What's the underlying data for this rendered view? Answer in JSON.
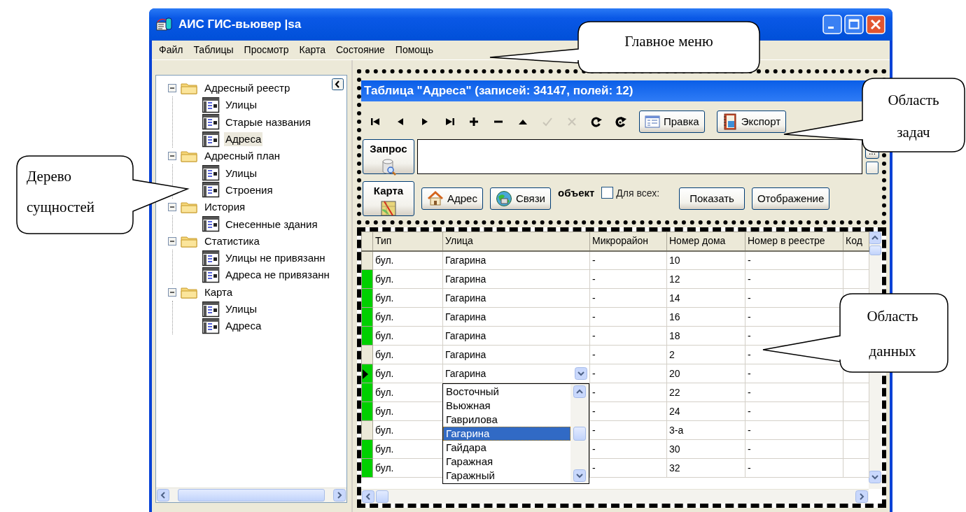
{
  "window": {
    "title": "АИС ГИС-вьювер |sa"
  },
  "menu": [
    "Файл",
    "Таблицы",
    "Просмотр",
    "Карта",
    "Состояние",
    "Помощь"
  ],
  "tree": [
    {
      "label": "Адресный реестр",
      "kind": "folder",
      "expanded": true,
      "selected": false,
      "children": [
        {
          "label": "Улицы",
          "kind": "table",
          "selected": false
        },
        {
          "label": "Старые названия",
          "kind": "table",
          "selected": false
        },
        {
          "label": "Адреса",
          "kind": "table",
          "selected": true
        }
      ]
    },
    {
      "label": "Адресный план",
      "kind": "folder",
      "expanded": true,
      "selected": false,
      "children": [
        {
          "label": "Улицы",
          "kind": "table",
          "selected": false
        },
        {
          "label": "Строения",
          "kind": "table",
          "selected": false
        }
      ]
    },
    {
      "label": "История",
      "kind": "folder",
      "expanded": true,
      "selected": false,
      "children": [
        {
          "label": "Снесенные здания",
          "kind": "table",
          "selected": false
        }
      ]
    },
    {
      "label": "Статистика",
      "kind": "folder",
      "expanded": true,
      "selected": false,
      "children": [
        {
          "label": "Улицы не привязанн",
          "kind": "table",
          "selected": false
        },
        {
          "label": "Адреса не привязанн",
          "kind": "table",
          "selected": false
        }
      ]
    },
    {
      "label": "Карта",
      "kind": "folder",
      "expanded": true,
      "selected": false,
      "children": [
        {
          "label": "Улицы",
          "kind": "table",
          "selected": false
        },
        {
          "label": "Адреса",
          "kind": "table",
          "selected": false
        }
      ]
    }
  ],
  "table_panel": {
    "title": "Таблица \"Адреса\" (записей: 34147, полей: 12)",
    "nav_buttons": [
      {
        "kind": "first",
        "disabled": false
      },
      {
        "kind": "prev",
        "disabled": false
      },
      {
        "kind": "next",
        "disabled": false
      },
      {
        "kind": "last",
        "disabled": false
      },
      {
        "kind": "insert",
        "disabled": false
      },
      {
        "kind": "delete",
        "disabled": false
      },
      {
        "kind": "edit",
        "disabled": false
      },
      {
        "kind": "post",
        "disabled": true
      },
      {
        "kind": "cancel",
        "disabled": true
      },
      {
        "kind": "refresh",
        "disabled": false
      },
      {
        "kind": "refresh_all",
        "disabled": false
      }
    ],
    "buttons": [
      {
        "label": "Правка",
        "kind": "form"
      },
      {
        "label": "Экспорт",
        "kind": "export"
      }
    ],
    "query_button": "Запрос",
    "ellipsis_button": "...",
    "map_button": "Карта",
    "link_buttons": [
      {
        "label": "Адрес",
        "kind": "house"
      },
      {
        "label": "Связи",
        "kind": "globe"
      }
    ],
    "object_label": "объект",
    "for_all": {
      "label": "Для всех:",
      "checked": false
    },
    "show_button": "Показать",
    "display_button": "Отображение"
  },
  "grid": {
    "columns": [
      "Тип",
      "Улица",
      "Микрорайон",
      "Номер дома",
      "Номер в реестре",
      "Код"
    ],
    "rows": [
      {
        "type": "бул.",
        "street": "Гагарина",
        "district": "-",
        "house": "10",
        "registry": "-",
        "marked": false,
        "selected": false
      },
      {
        "type": "бул.",
        "street": "Гагарина",
        "district": "-",
        "house": "12",
        "registry": "-",
        "marked": true,
        "selected": false
      },
      {
        "type": "бул.",
        "street": "Гагарина",
        "district": "-",
        "house": "14",
        "registry": "-",
        "marked": true,
        "selected": false
      },
      {
        "type": "бул.",
        "street": "Гагарина",
        "district": "-",
        "house": "16",
        "registry": "-",
        "marked": true,
        "selected": false
      },
      {
        "type": "бул.",
        "street": "Гагарина",
        "district": "-",
        "house": "18",
        "registry": "-",
        "marked": true,
        "selected": false
      },
      {
        "type": "бул.",
        "street": "Гагарина",
        "district": "-",
        "house": "2",
        "registry": "-",
        "marked": false,
        "selected": false
      },
      {
        "type": "бул.",
        "street": "Гагарина",
        "district": "-",
        "house": "20",
        "registry": "-",
        "marked": true,
        "selected": true
      },
      {
        "type": "бул.",
        "district": "-",
        "house": "22",
        "registry": "-",
        "marked": true,
        "selected": false
      },
      {
        "type": "бул.",
        "district": "-",
        "house": "24",
        "registry": "-",
        "marked": true,
        "selected": false
      },
      {
        "type": "бул.",
        "district": "-",
        "house": "3-а",
        "registry": "-",
        "marked": false,
        "selected": false
      },
      {
        "type": "бул.",
        "district": "-",
        "house": "30",
        "registry": "-",
        "marked": true,
        "selected": false
      },
      {
        "type": "бул.",
        "district": "-",
        "house": "32",
        "registry": "-",
        "marked": true,
        "selected": false
      }
    ],
    "dropdown": [
      {
        "label": "Восточный",
        "selected": false
      },
      {
        "label": "Вьюжная",
        "selected": false
      },
      {
        "label": "Гаврилова",
        "selected": false
      },
      {
        "label": "Гагарина",
        "selected": true
      },
      {
        "label": "Гайдара",
        "selected": false
      },
      {
        "label": "Гаражная",
        "selected": false
      },
      {
        "label": "Гаражный",
        "selected": false
      }
    ]
  },
  "callouts": [
    {
      "text": "Главное меню"
    },
    {
      "text": "Область задач"
    },
    {
      "text": "Дерево сущностей"
    },
    {
      "text": "Область данных"
    }
  ]
}
